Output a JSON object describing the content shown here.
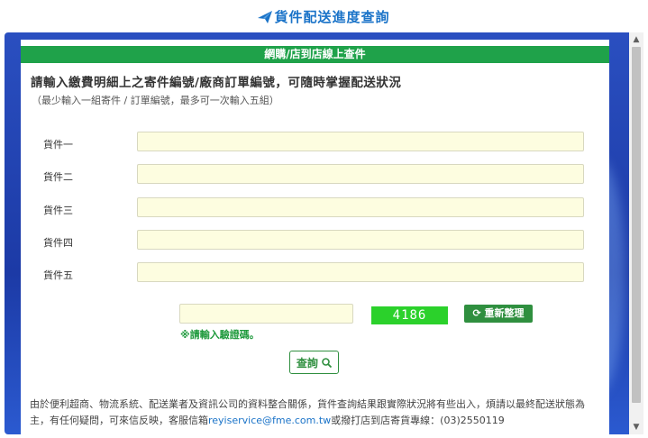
{
  "page": {
    "title": "貨件配送進度查詢"
  },
  "panel": {
    "header": "網購/店到店線上查件",
    "instruction": "請輸入繳費明細上之寄件編號/廠商訂單編號，可隨時掌握配送狀況",
    "hint": "（最少輸入一組寄件 / 訂單編號，最多可一次輸入五組）"
  },
  "rows": [
    {
      "label": "貨件一",
      "value": ""
    },
    {
      "label": "貨件二",
      "value": ""
    },
    {
      "label": "貨件三",
      "value": ""
    },
    {
      "label": "貨件四",
      "value": ""
    },
    {
      "label": "貨件五",
      "value": ""
    }
  ],
  "captcha": {
    "value": "",
    "code": "4186",
    "refresh_label": "重新整理",
    "hint": "※請輸入驗證碼。"
  },
  "query": {
    "label": "查詢"
  },
  "notice": {
    "text_before": "由於便利超商、物流系統、配送業者及資訊公司的資料整合關係，貨件查詢結果跟實際狀況將有些出入，煩請以最終配送狀態為主，有任何疑問，可來信反映，客服信箱",
    "email": "reyiservice@fme.com.tw",
    "text_after": "或撥打店到店寄貨專線：(03)2550119"
  },
  "icons": {
    "title_icon": "paper-plane-icon",
    "refresh_icon": "refresh-icon",
    "query_icon": "search-icon"
  },
  "colors": {
    "title": "#1a73c8",
    "header": "#1fa24a",
    "captcha_bg": "#2bd12b",
    "frame": "#2a4fc0"
  }
}
